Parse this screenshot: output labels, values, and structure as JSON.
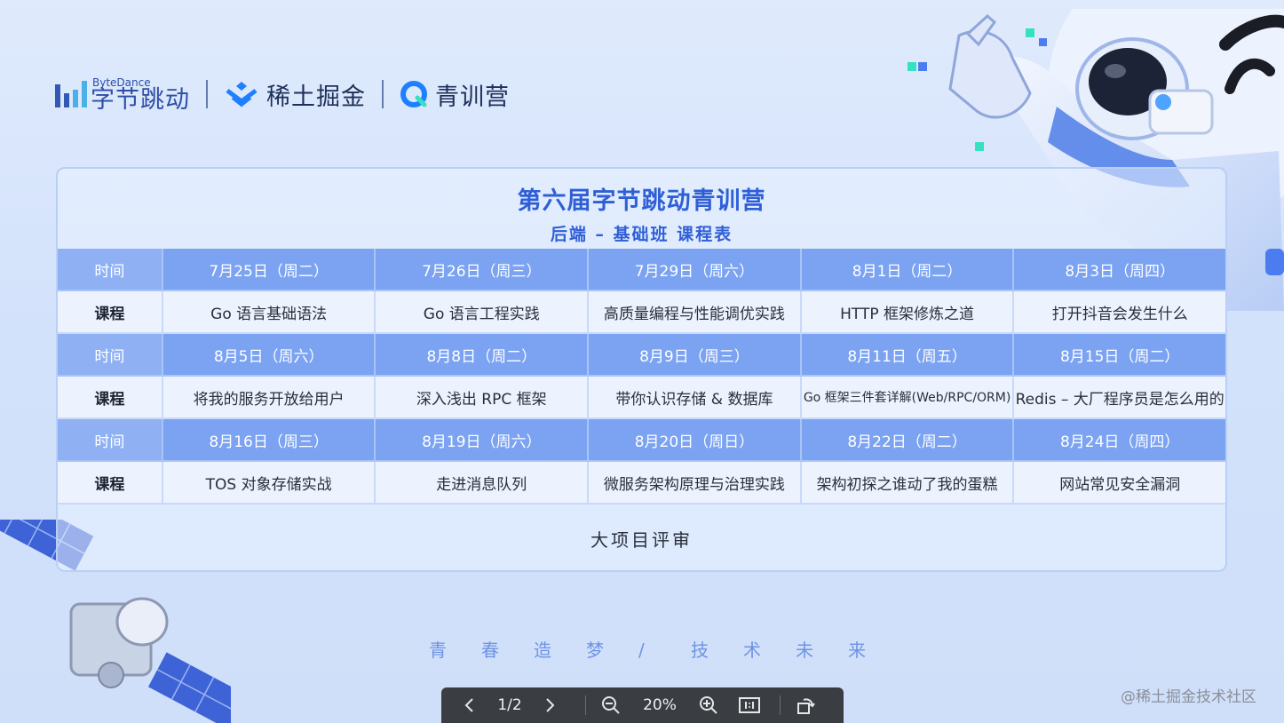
{
  "logos": {
    "bytedance_en": "ByteDance",
    "bytedance_cn": "字节跳动",
    "juejin": "稀土掘金",
    "qingxunying": "青训营"
  },
  "card": {
    "title": "第六届字节跳动青训营",
    "subtitle": "后端 – 基础班 课程表"
  },
  "schedule": [
    {
      "time_label": "时间",
      "course_label": "课程",
      "dates": [
        "7月25日（周二）",
        "7月26日（周三）",
        "7月29日（周六）",
        "8月1日（周二）",
        "8月3日（周四）"
      ],
      "courses": [
        "Go 语言基础语法",
        "Go 语言工程实践",
        "高质量编程与性能调优实践",
        "HTTP 框架修炼之道",
        "打开抖音会发生什么"
      ]
    },
    {
      "time_label": "时间",
      "course_label": "课程",
      "dates": [
        "8月5日（周六）",
        "8月8日（周二）",
        "8月9日（周三）",
        "8月11日（周五）",
        "8月15日（周二）"
      ],
      "courses": [
        "将我的服务开放给用户",
        "深入浅出 RPC 框架",
        "带你认识存储 & 数据库",
        "Go 框架三件套详解(Web/RPC/ORM)",
        "Redis – 大厂程序员是怎么用的"
      ]
    },
    {
      "time_label": "时间",
      "course_label": "课程",
      "dates": [
        "8月16日（周三）",
        "8月19日（周六）",
        "8月20日（周日）",
        "8月22日（周二）",
        "8月24日（周四）"
      ],
      "courses": [
        "TOS 对象存储实战",
        "走进消息队列",
        "微服务架构原理与治理实践",
        "架构初探之谁动了我的蛋糕",
        "网站常见安全漏洞"
      ]
    }
  ],
  "final_row": "大项目评审",
  "slogan": [
    "青",
    "春",
    "造",
    "梦",
    "/",
    "技",
    "术",
    "未",
    "来"
  ],
  "toolbar": {
    "prev_icon": "chevron-left-icon",
    "page": "1/2",
    "next_icon": "chevron-right-icon",
    "zoom_out_icon": "zoom-out-icon",
    "zoom": "20%",
    "zoom_in_icon": "zoom-in-icon",
    "actual_size_icon": "one-to-one-icon",
    "rotate_icon": "rotate-icon"
  },
  "watermark": "@稀土掘金技术社区",
  "colors": {
    "accent": "#2f5fd6",
    "time_row": "#7ba3f2",
    "course_row": "#edf3fe",
    "toolbar": "#3a3d42"
  }
}
